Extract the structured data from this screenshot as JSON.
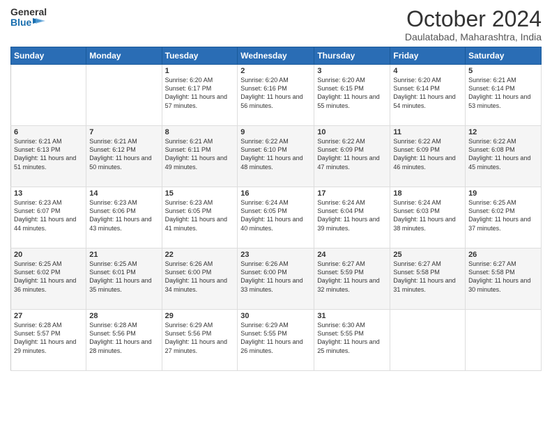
{
  "header": {
    "logo_line1": "General",
    "logo_line2": "Blue",
    "month": "October 2024",
    "location": "Daulatabad, Maharashtra, India"
  },
  "weekdays": [
    "Sunday",
    "Monday",
    "Tuesday",
    "Wednesday",
    "Thursday",
    "Friday",
    "Saturday"
  ],
  "weeks": [
    [
      {
        "day": "",
        "sunrise": "",
        "sunset": "",
        "daylight": ""
      },
      {
        "day": "",
        "sunrise": "",
        "sunset": "",
        "daylight": ""
      },
      {
        "day": "1",
        "sunrise": "Sunrise: 6:20 AM",
        "sunset": "Sunset: 6:17 PM",
        "daylight": "Daylight: 11 hours and 57 minutes."
      },
      {
        "day": "2",
        "sunrise": "Sunrise: 6:20 AM",
        "sunset": "Sunset: 6:16 PM",
        "daylight": "Daylight: 11 hours and 56 minutes."
      },
      {
        "day": "3",
        "sunrise": "Sunrise: 6:20 AM",
        "sunset": "Sunset: 6:15 PM",
        "daylight": "Daylight: 11 hours and 55 minutes."
      },
      {
        "day": "4",
        "sunrise": "Sunrise: 6:20 AM",
        "sunset": "Sunset: 6:14 PM",
        "daylight": "Daylight: 11 hours and 54 minutes."
      },
      {
        "day": "5",
        "sunrise": "Sunrise: 6:21 AM",
        "sunset": "Sunset: 6:14 PM",
        "daylight": "Daylight: 11 hours and 53 minutes."
      }
    ],
    [
      {
        "day": "6",
        "sunrise": "Sunrise: 6:21 AM",
        "sunset": "Sunset: 6:13 PM",
        "daylight": "Daylight: 11 hours and 51 minutes."
      },
      {
        "day": "7",
        "sunrise": "Sunrise: 6:21 AM",
        "sunset": "Sunset: 6:12 PM",
        "daylight": "Daylight: 11 hours and 50 minutes."
      },
      {
        "day": "8",
        "sunrise": "Sunrise: 6:21 AM",
        "sunset": "Sunset: 6:11 PM",
        "daylight": "Daylight: 11 hours and 49 minutes."
      },
      {
        "day": "9",
        "sunrise": "Sunrise: 6:22 AM",
        "sunset": "Sunset: 6:10 PM",
        "daylight": "Daylight: 11 hours and 48 minutes."
      },
      {
        "day": "10",
        "sunrise": "Sunrise: 6:22 AM",
        "sunset": "Sunset: 6:09 PM",
        "daylight": "Daylight: 11 hours and 47 minutes."
      },
      {
        "day": "11",
        "sunrise": "Sunrise: 6:22 AM",
        "sunset": "Sunset: 6:09 PM",
        "daylight": "Daylight: 11 hours and 46 minutes."
      },
      {
        "day": "12",
        "sunrise": "Sunrise: 6:22 AM",
        "sunset": "Sunset: 6:08 PM",
        "daylight": "Daylight: 11 hours and 45 minutes."
      }
    ],
    [
      {
        "day": "13",
        "sunrise": "Sunrise: 6:23 AM",
        "sunset": "Sunset: 6:07 PM",
        "daylight": "Daylight: 11 hours and 44 minutes."
      },
      {
        "day": "14",
        "sunrise": "Sunrise: 6:23 AM",
        "sunset": "Sunset: 6:06 PM",
        "daylight": "Daylight: 11 hours and 43 minutes."
      },
      {
        "day": "15",
        "sunrise": "Sunrise: 6:23 AM",
        "sunset": "Sunset: 6:05 PM",
        "daylight": "Daylight: 11 hours and 41 minutes."
      },
      {
        "day": "16",
        "sunrise": "Sunrise: 6:24 AM",
        "sunset": "Sunset: 6:05 PM",
        "daylight": "Daylight: 11 hours and 40 minutes."
      },
      {
        "day": "17",
        "sunrise": "Sunrise: 6:24 AM",
        "sunset": "Sunset: 6:04 PM",
        "daylight": "Daylight: 11 hours and 39 minutes."
      },
      {
        "day": "18",
        "sunrise": "Sunrise: 6:24 AM",
        "sunset": "Sunset: 6:03 PM",
        "daylight": "Daylight: 11 hours and 38 minutes."
      },
      {
        "day": "19",
        "sunrise": "Sunrise: 6:25 AM",
        "sunset": "Sunset: 6:02 PM",
        "daylight": "Daylight: 11 hours and 37 minutes."
      }
    ],
    [
      {
        "day": "20",
        "sunrise": "Sunrise: 6:25 AM",
        "sunset": "Sunset: 6:02 PM",
        "daylight": "Daylight: 11 hours and 36 minutes."
      },
      {
        "day": "21",
        "sunrise": "Sunrise: 6:25 AM",
        "sunset": "Sunset: 6:01 PM",
        "daylight": "Daylight: 11 hours and 35 minutes."
      },
      {
        "day": "22",
        "sunrise": "Sunrise: 6:26 AM",
        "sunset": "Sunset: 6:00 PM",
        "daylight": "Daylight: 11 hours and 34 minutes."
      },
      {
        "day": "23",
        "sunrise": "Sunrise: 6:26 AM",
        "sunset": "Sunset: 6:00 PM",
        "daylight": "Daylight: 11 hours and 33 minutes."
      },
      {
        "day": "24",
        "sunrise": "Sunrise: 6:27 AM",
        "sunset": "Sunset: 5:59 PM",
        "daylight": "Daylight: 11 hours and 32 minutes."
      },
      {
        "day": "25",
        "sunrise": "Sunrise: 6:27 AM",
        "sunset": "Sunset: 5:58 PM",
        "daylight": "Daylight: 11 hours and 31 minutes."
      },
      {
        "day": "26",
        "sunrise": "Sunrise: 6:27 AM",
        "sunset": "Sunset: 5:58 PM",
        "daylight": "Daylight: 11 hours and 30 minutes."
      }
    ],
    [
      {
        "day": "27",
        "sunrise": "Sunrise: 6:28 AM",
        "sunset": "Sunset: 5:57 PM",
        "daylight": "Daylight: 11 hours and 29 minutes."
      },
      {
        "day": "28",
        "sunrise": "Sunrise: 6:28 AM",
        "sunset": "Sunset: 5:56 PM",
        "daylight": "Daylight: 11 hours and 28 minutes."
      },
      {
        "day": "29",
        "sunrise": "Sunrise: 6:29 AM",
        "sunset": "Sunset: 5:56 PM",
        "daylight": "Daylight: 11 hours and 27 minutes."
      },
      {
        "day": "30",
        "sunrise": "Sunrise: 6:29 AM",
        "sunset": "Sunset: 5:55 PM",
        "daylight": "Daylight: 11 hours and 26 minutes."
      },
      {
        "day": "31",
        "sunrise": "Sunrise: 6:30 AM",
        "sunset": "Sunset: 5:55 PM",
        "daylight": "Daylight: 11 hours and 25 minutes."
      },
      {
        "day": "",
        "sunrise": "",
        "sunset": "",
        "daylight": ""
      },
      {
        "day": "",
        "sunrise": "",
        "sunset": "",
        "daylight": ""
      }
    ]
  ]
}
